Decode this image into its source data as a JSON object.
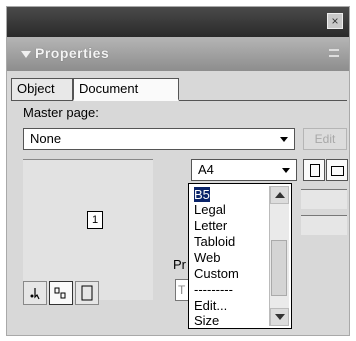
{
  "window": {
    "close_glyph": "×",
    "title": "Properties"
  },
  "tabs": [
    {
      "label": "Object"
    },
    {
      "label": "Document"
    }
  ],
  "master_page": {
    "label": "Master page:",
    "value": "None",
    "edit_label": "Edit"
  },
  "page_preview": {
    "page_number": "1"
  },
  "size_dropdown": {
    "value": "A4"
  },
  "size_list": {
    "items": [
      "B5",
      "Legal",
      "Letter",
      "Tabloid",
      "Web",
      "Custom",
      "---------",
      "Edit...",
      "Size"
    ],
    "selected_index": 0
  },
  "pr_label": "Pr",
  "pr_field_value": "T"
}
